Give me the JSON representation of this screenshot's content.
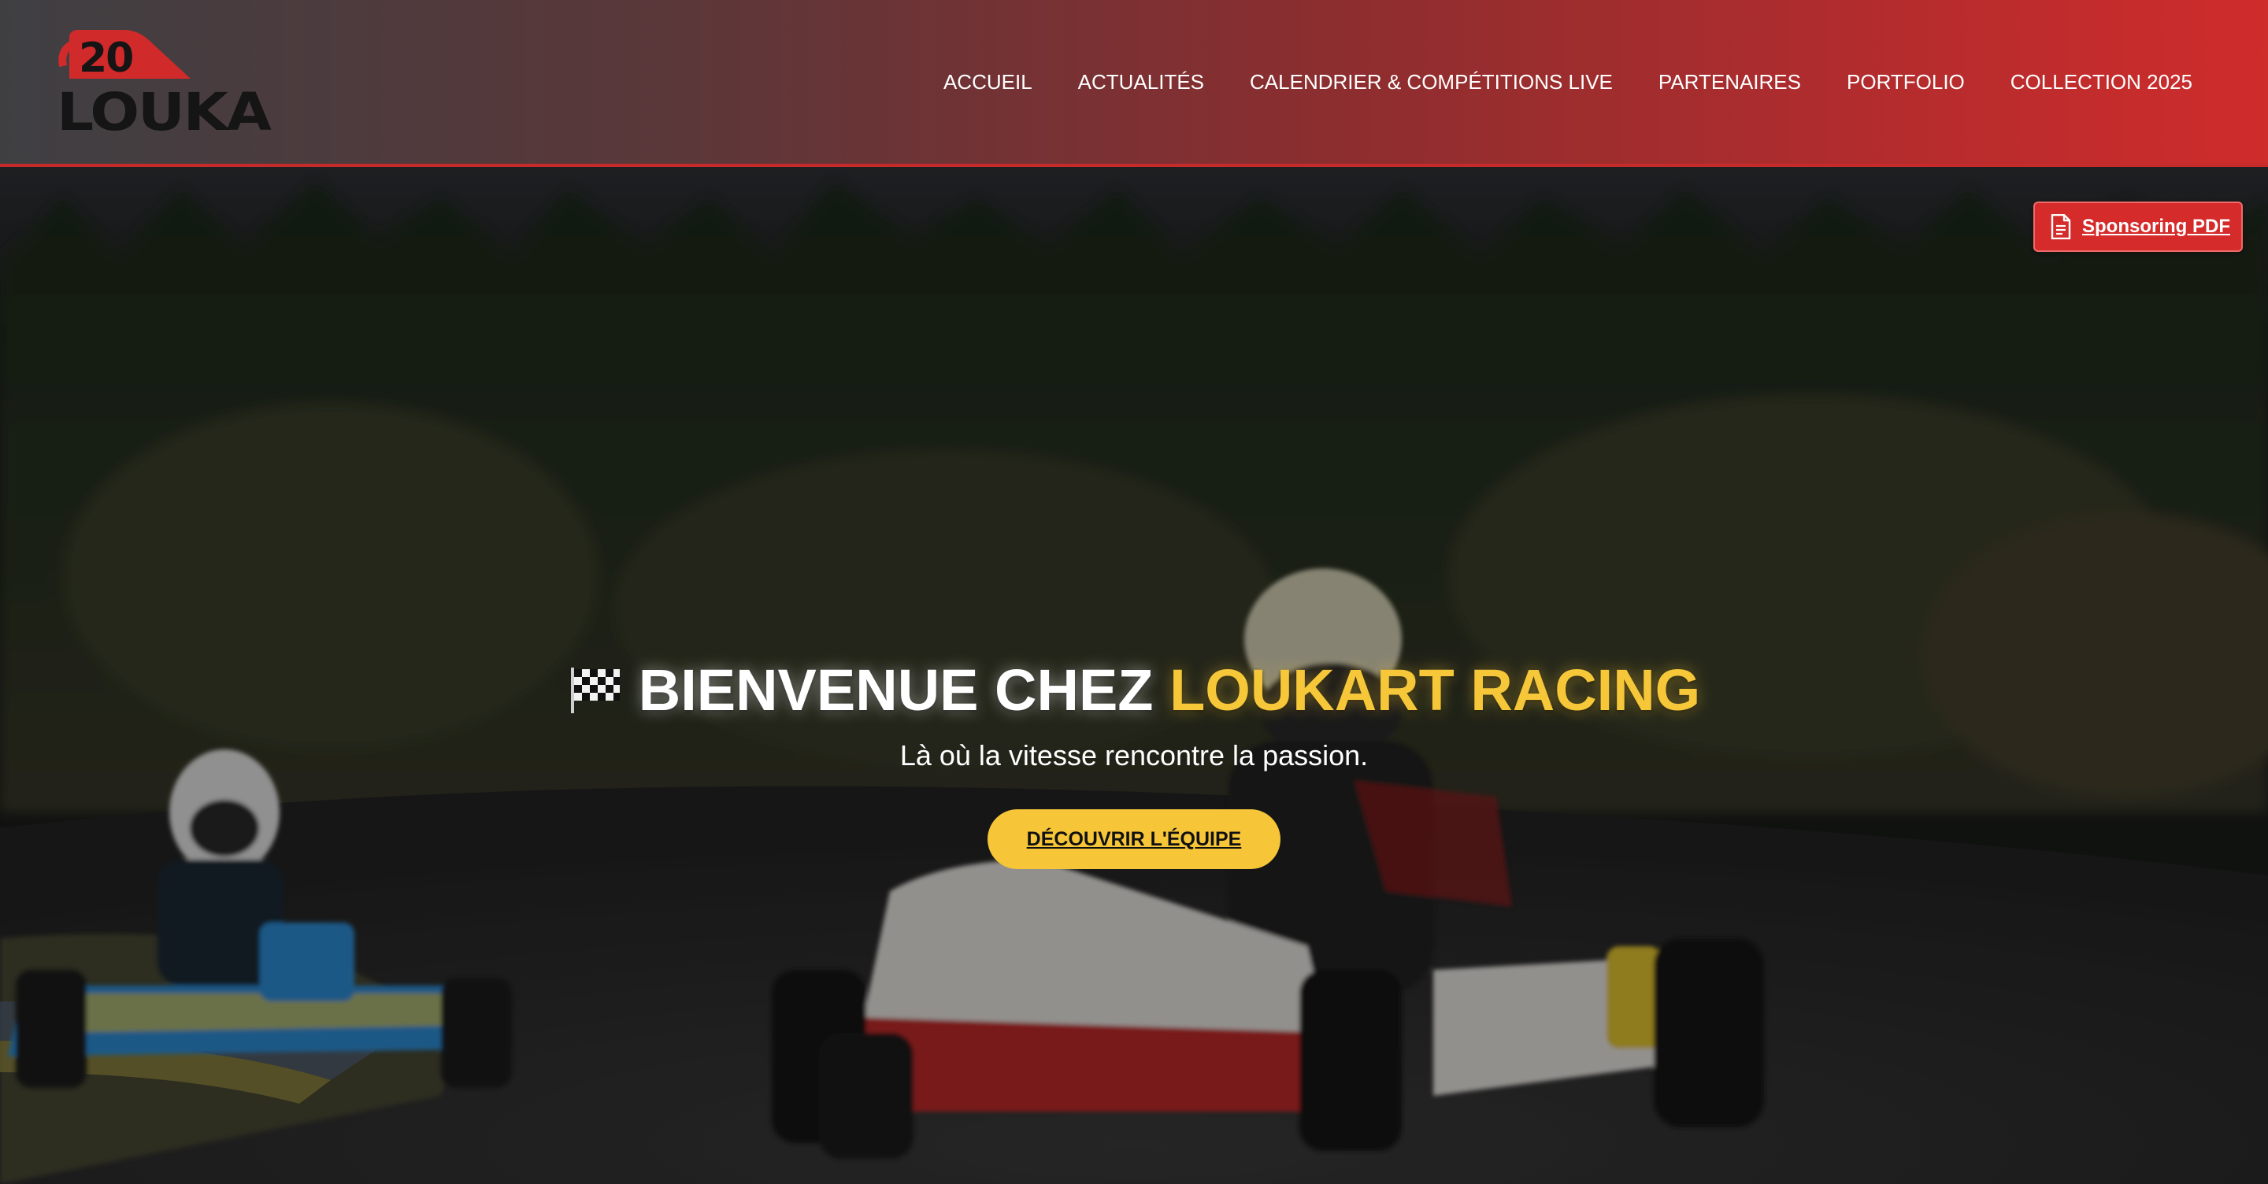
{
  "logo": {
    "number": "20",
    "name": "LOUKA"
  },
  "nav": {
    "items": [
      {
        "label": "ACCUEIL"
      },
      {
        "label": "ACTUALITÉS"
      },
      {
        "label": "CALENDRIER & COMPÉTITIONS LIVE"
      },
      {
        "label": "PARTENAIRES"
      },
      {
        "label": "PORTFOLIO"
      },
      {
        "label": "COLLECTION 2025"
      }
    ]
  },
  "sponsor": {
    "label": "Sponsoring PDF",
    "icon": "file-text-icon"
  },
  "hero": {
    "flag_icon": "checkered-flag-icon",
    "title_white": "BIENVENUE CHEZ",
    "title_accent": "LOUKART RACING",
    "subtitle": "Là où la vitesse rencontre la passion.",
    "cta_label": "DÉCOUVRIR L'ÉQUIPE"
  },
  "colors": {
    "accent_yellow": "#f6c738",
    "brand_red": "#d52b2b",
    "header_dark": "#3f3f42"
  }
}
